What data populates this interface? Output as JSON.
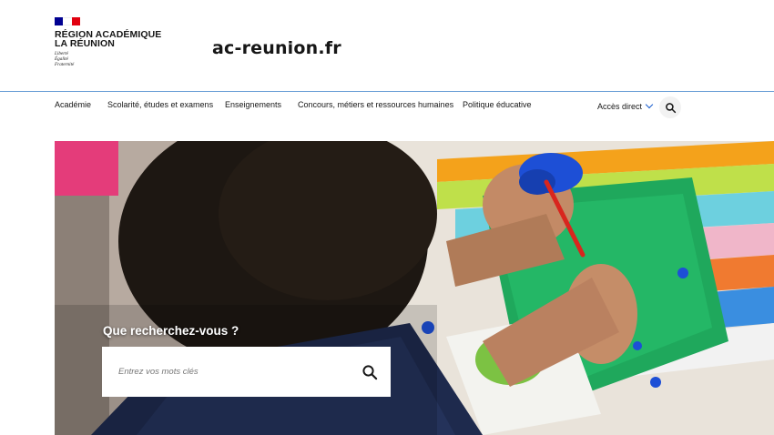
{
  "brand": {
    "region_line1": "RÉGION ACADÉMIQUE",
    "region_line2": "LA RÉUNION",
    "motto": [
      "Liberté",
      "Égalité",
      "Fraternité"
    ],
    "site_title": "ac-reunion.fr",
    "flag_colors": [
      "#000091",
      "#ffffff",
      "#e1000f"
    ]
  },
  "nav": {
    "items": [
      {
        "label": "Académie"
      },
      {
        "label": "Scolarité, études et examens"
      },
      {
        "label": "Enseignements"
      },
      {
        "label": "Concours, métiers et ressources humaines"
      },
      {
        "label": "Politique éducative"
      }
    ],
    "access_label": "Accès direct",
    "search_icon": "search-icon"
  },
  "hero": {
    "question": "Que recherchez-vous ?",
    "search": {
      "placeholder": "Entrez vos mots clés",
      "value": "",
      "icon": "search-icon"
    }
  },
  "colors": {
    "accent_blue": "#1b5fcf",
    "divider": "#6a9fd6",
    "text": "#161616"
  }
}
